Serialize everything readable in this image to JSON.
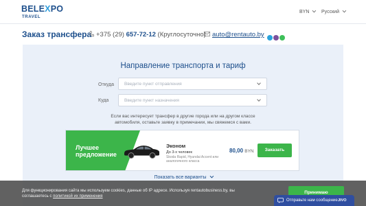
{
  "header": {
    "logo_main_a": "BELE",
    "logo_main_x": "X",
    "logo_main_b": "PO",
    "logo_sub": "TRAVEL",
    "currency": "BYN",
    "language": "Русский"
  },
  "title_row": {
    "page_title": "Заказ трансфера",
    "phone_prefix": "+375 (29) ",
    "phone_number": "657-72-12",
    "phone_note": " (Круглосуточно)",
    "email": "auto@rentauto.by"
  },
  "form": {
    "title": "Направление транспорта и тариф",
    "from_label": "Откуда",
    "from_placeholder": "Введите пункт отправления",
    "to_label": "Куда",
    "to_placeholder": "Введите пункт назначения",
    "hint": "Если вас интересует трансфер в другие города или на другом классе автомобиля, оставьте заявку в примечании, мы свяжемся с вами."
  },
  "offer": {
    "badge": "Лучшее предложение",
    "class_name": "Эконом",
    "capacity": "До 3-х человек",
    "models": "Skoda Rapid, Hyundai Accent или аналогичного класса",
    "price": "80,00",
    "currency": "BYN",
    "order_label": "Заказать"
  },
  "show_all": "Показать все варианты",
  "cookie": {
    "text": "Для функционирования сайта мы используем cookies, данные об IP адресе. Используя rentautobusiness.by, вы соглашаетесь с ",
    "link": "политикой их применения",
    "accept": "Принимаю"
  },
  "chat": {
    "label": "Отправьте нам сообщение",
    "brand": "JIVO"
  },
  "colors": {
    "brand_blue": "#1d4f8c",
    "accent_green": "#3cb54a",
    "panel_bg": "#eaf0f9"
  }
}
